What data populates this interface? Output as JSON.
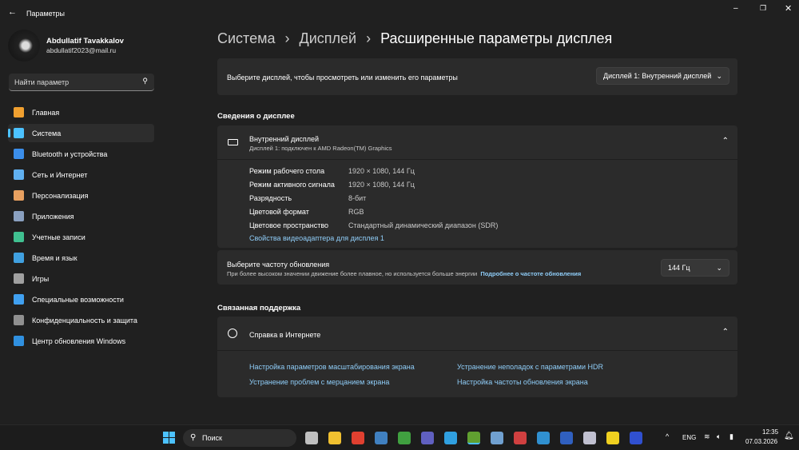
{
  "window": {
    "title": "Параметры"
  },
  "user": {
    "name": "Abdullatif Tavakkalov",
    "email": "abdullatif2023@mail.ru"
  },
  "search": {
    "placeholder": "Найти параметр"
  },
  "sidebar": {
    "items": [
      {
        "label": "Главная",
        "color": "#f0a030"
      },
      {
        "label": "Система",
        "color": "#4cc2ff"
      },
      {
        "label": "Bluetooth и устройства",
        "color": "#3b8eea"
      },
      {
        "label": "Сеть и Интернет",
        "color": "#60b0f0"
      },
      {
        "label": "Персонализация",
        "color": "#e8a060"
      },
      {
        "label": "Приложения",
        "color": "#8aa0c0"
      },
      {
        "label": "Учетные записи",
        "color": "#40c090"
      },
      {
        "label": "Время и язык",
        "color": "#40a0e0"
      },
      {
        "label": "Игры",
        "color": "#a0a0a0"
      },
      {
        "label": "Специальные возможности",
        "color": "#40a0f0"
      },
      {
        "label": "Конфиденциальность и защита",
        "color": "#909090"
      },
      {
        "label": "Центр обновления Windows",
        "color": "#3090e0"
      }
    ]
  },
  "breadcrumb": [
    "Система",
    "Дисплей",
    "Расширенные параметры дисплея"
  ],
  "select_display": {
    "label": "Выберите дисплей, чтобы просмотреть или изменить его параметры",
    "value": "Дисплей 1: Внутренний дисплей"
  },
  "display_info": {
    "section": "Сведения о дисплее",
    "title": "Внутренний дисплей",
    "subtitle": "Дисплей 1: подключен к AMD Radeon(TM) Graphics",
    "rows": [
      {
        "k": "Режим рабочего стола",
        "v": "1920 × 1080, 144 Гц"
      },
      {
        "k": "Режим активного сигнала",
        "v": "1920 × 1080, 144 Гц"
      },
      {
        "k": "Разрядность",
        "v": "8-бит"
      },
      {
        "k": "Цветовой формат",
        "v": "RGB"
      },
      {
        "k": "Цветовое пространство",
        "v": "Стандартный динамический диапазон (SDR)"
      }
    ],
    "link": "Свойства видеоадаптера для дисплея 1"
  },
  "refresh": {
    "title": "Выберите частоту обновления",
    "desc": "При более высоком значении движение более плавное, но используется больше энергии",
    "link": "Подробнее о частоте обновления",
    "value": "144 Гц"
  },
  "support": {
    "section": "Связанная поддержка",
    "title": "Справка в Интернете",
    "links": [
      "Настройка параметров масштабирования экрана",
      "Устранение неполадок с параметрами HDR",
      "Устранение проблем с мерцанием экрана",
      "Настройка частоты обновления экрана"
    ]
  },
  "taskbar": {
    "search": "Поиск",
    "lang": "ENG",
    "time": "12:35",
    "date": "07.03.2026",
    "apps": [
      "#c0c0c0",
      "#f0c030",
      "#e04030",
      "#4080c0",
      "#40a040",
      "#6060c0",
      "#30a0e0",
      "#60a030",
      "#70a0d0",
      "#d04040",
      "#3090d0",
      "#3060c0",
      "#c0c0d0",
      "#f0d020",
      "#3050d0"
    ]
  }
}
